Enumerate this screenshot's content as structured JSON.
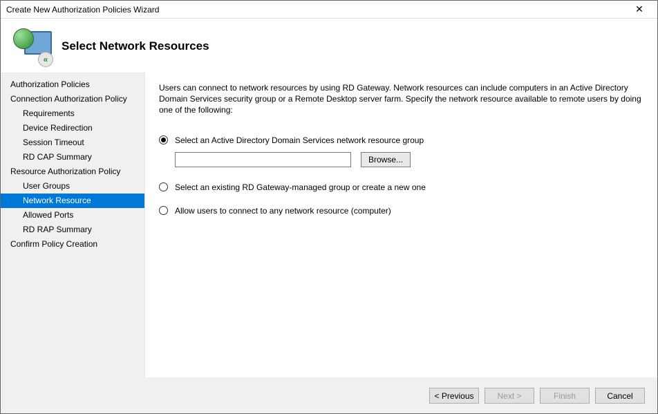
{
  "window": {
    "title": "Create New Authorization Policies Wizard",
    "close": "✕"
  },
  "header": {
    "title": "Select Network Resources",
    "badge": "«"
  },
  "sidebar": {
    "items": [
      {
        "label": "Authorization Policies",
        "sub": false
      },
      {
        "label": "Connection Authorization Policy",
        "sub": false
      },
      {
        "label": "Requirements",
        "sub": true
      },
      {
        "label": "Device Redirection",
        "sub": true
      },
      {
        "label": "Session Timeout",
        "sub": true
      },
      {
        "label": "RD CAP Summary",
        "sub": true
      },
      {
        "label": "Resource Authorization Policy",
        "sub": false
      },
      {
        "label": "User Groups",
        "sub": true
      },
      {
        "label": "Network Resource",
        "sub": true,
        "selected": true
      },
      {
        "label": "Allowed Ports",
        "sub": true
      },
      {
        "label": "RD RAP Summary",
        "sub": true
      },
      {
        "label": "Confirm Policy Creation",
        "sub": false
      }
    ]
  },
  "main": {
    "intro": "Users can connect to network resources by using RD Gateway. Network resources can include computers in an Active Directory Domain Services security group or a Remote Desktop server farm. Specify the network resource available to remote users by doing one of the following:",
    "options": {
      "ad_group": "Select an Active Directory Domain Services network resource group",
      "existing": "Select an existing RD Gateway-managed group or create a new one",
      "any": "Allow users to connect to any network resource (computer)"
    },
    "input_value": "",
    "browse": "Browse..."
  },
  "footer": {
    "previous": "< Previous",
    "next": "Next >",
    "finish": "Finish",
    "cancel": "Cancel"
  }
}
